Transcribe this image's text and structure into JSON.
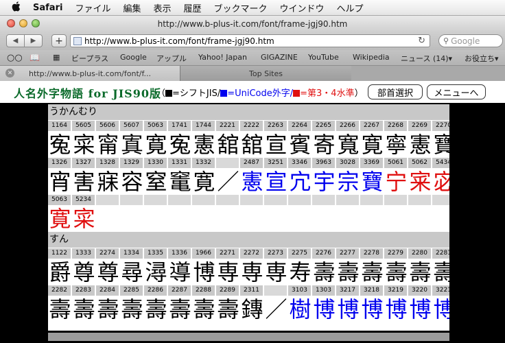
{
  "menubar": {
    "app": "Safari",
    "items": [
      "ファイル",
      "編集",
      "表示",
      "履歴",
      "ブックマーク",
      "ウインドウ",
      "ヘルプ"
    ]
  },
  "window": {
    "title": "http://www.b-plus-it.com/font/frame-jgj90.htm"
  },
  "toolbar": {
    "back": "◀",
    "forward": "▶",
    "add": "+",
    "url": "http://www.b-plus-it.com/font/frame-jgj90.htm",
    "search_placeholder": "Google"
  },
  "bookmarks": [
    {
      "label": "ビープラス"
    },
    {
      "label": "Google"
    },
    {
      "label": "アップル"
    },
    {
      "label": "Yahoo! Japan"
    },
    {
      "label": "GIGAZINE"
    },
    {
      "label": "YouTube"
    },
    {
      "label": "Wikipedia"
    },
    {
      "label": "ニュース (14)▾"
    },
    {
      "label": "お役立ち▾"
    }
  ],
  "tabs": [
    {
      "label": "http://www.b-plus-it.com/font/f..."
    },
    {
      "label": "Top Sites"
    }
  ],
  "header": {
    "title": "人名外字物語 for JIS90版",
    "legend": {
      "open": "（",
      "black_label": "=シフトJIS/",
      "blue_label": "=UniCode外字/",
      "red_label": "=第3・4水準",
      "close": "）"
    },
    "buttons": {
      "bushu": "部首選択",
      "menu": "メニューへ"
    }
  },
  "colors": {
    "shiftjis": "#000000",
    "unicode": "#0000ee",
    "level34": "#e01010",
    "title_green": "#0a6a2a"
  },
  "sections": [
    {
      "name": "うかんむり",
      "rows": [
        {
          "codes": [
            "1164",
            "5605",
            "5606",
            "5607",
            "5063",
            "1741",
            "1744",
            "2221",
            "2222",
            "2263",
            "2264",
            "2265",
            "2266",
            "2267",
            "2268",
            "2269",
            "2270"
          ],
          "chars": [
            {
              "t": "寃",
              "c": "black"
            },
            {
              "t": "寀",
              "c": "black"
            },
            {
              "t": "甯",
              "c": "black"
            },
            {
              "t": "寘",
              "c": "black"
            },
            {
              "t": "寛",
              "c": "black"
            },
            {
              "t": "寃",
              "c": "black"
            },
            {
              "t": "憲",
              "c": "black"
            },
            {
              "t": "舘",
              "c": "black"
            },
            {
              "t": "舘",
              "c": "black"
            },
            {
              "t": "宣",
              "c": "black"
            },
            {
              "t": "賓",
              "c": "black"
            },
            {
              "t": "寄",
              "c": "black"
            },
            {
              "t": "寬",
              "c": "black"
            },
            {
              "t": "寛",
              "c": "black"
            },
            {
              "t": "寧",
              "c": "black"
            },
            {
              "t": "憲",
              "c": "black"
            },
            {
              "t": "寶",
              "c": "black"
            }
          ]
        },
        {
          "codes": [
            "1326",
            "1327",
            "1328",
            "1329",
            "1330",
            "1331",
            "1332",
            "",
            "2487",
            "3251",
            "3346",
            "3963",
            "3028",
            "3369",
            "5061",
            "5062",
            "5434"
          ],
          "chars": [
            {
              "t": "宵",
              "c": "black"
            },
            {
              "t": "害",
              "c": "black"
            },
            {
              "t": "寐",
              "c": "black"
            },
            {
              "t": "容",
              "c": "black"
            },
            {
              "t": "窒",
              "c": "black"
            },
            {
              "t": "竃",
              "c": "black"
            },
            {
              "t": "寛",
              "c": "black"
            },
            {
              "t": "／",
              "c": "black"
            },
            {
              "t": "憲",
              "c": "blue"
            },
            {
              "t": "宣",
              "c": "blue"
            },
            {
              "t": "宂",
              "c": "blue"
            },
            {
              "t": "宇",
              "c": "blue"
            },
            {
              "t": "宗",
              "c": "blue"
            },
            {
              "t": "寶",
              "c": "blue"
            },
            {
              "t": "宁",
              "c": "red"
            },
            {
              "t": "宷",
              "c": "red"
            },
            {
              "t": "宓",
              "c": "red"
            }
          ]
        },
        {
          "codes": [
            "5063",
            "5234",
            "",
            "",
            "",
            "",
            "",
            "",
            "",
            "",
            "",
            "",
            "",
            "",
            "",
            "",
            ""
          ],
          "chars": [
            {
              "t": "寛",
              "c": "red"
            },
            {
              "t": "寀",
              "c": "red"
            }
          ]
        }
      ]
    },
    {
      "name": "すん",
      "rows": [
        {
          "codes": [
            "1122",
            "1333",
            "2274",
            "1334",
            "1335",
            "1336",
            "1966",
            "2271",
            "2272",
            "2273",
            "2275",
            "2276",
            "2277",
            "2278",
            "2279",
            "2280",
            "2281"
          ],
          "chars": [
            {
              "t": "爵",
              "c": "black"
            },
            {
              "t": "尊",
              "c": "black"
            },
            {
              "t": "尊",
              "c": "black"
            },
            {
              "t": "尋",
              "c": "black"
            },
            {
              "t": "潯",
              "c": "black"
            },
            {
              "t": "導",
              "c": "black"
            },
            {
              "t": "博",
              "c": "black"
            },
            {
              "t": "専",
              "c": "black"
            },
            {
              "t": "専",
              "c": "black"
            },
            {
              "t": "専",
              "c": "black"
            },
            {
              "t": "寿",
              "c": "black"
            },
            {
              "t": "壽",
              "c": "black"
            },
            {
              "t": "壽",
              "c": "black"
            },
            {
              "t": "壽",
              "c": "black"
            },
            {
              "t": "壽",
              "c": "black"
            },
            {
              "t": "壽",
              "c": "black"
            },
            {
              "t": "壽",
              "c": "black"
            }
          ]
        },
        {
          "codes": [
            "2282",
            "2283",
            "2284",
            "2285",
            "2286",
            "2287",
            "2288",
            "2289",
            "2311",
            "",
            "3103",
            "1303",
            "3217",
            "3218",
            "3219",
            "3220",
            "3221"
          ],
          "chars": [
            {
              "t": "壽",
              "c": "black"
            },
            {
              "t": "壽",
              "c": "black"
            },
            {
              "t": "壽",
              "c": "black"
            },
            {
              "t": "壽",
              "c": "black"
            },
            {
              "t": "壽",
              "c": "black"
            },
            {
              "t": "壽",
              "c": "black"
            },
            {
              "t": "壽",
              "c": "black"
            },
            {
              "t": "壽",
              "c": "black"
            },
            {
              "t": "鏄",
              "c": "black"
            },
            {
              "t": "／",
              "c": "black"
            },
            {
              "t": "樹",
              "c": "blue"
            },
            {
              "t": "博",
              "c": "blue"
            },
            {
              "t": "博",
              "c": "blue"
            },
            {
              "t": "博",
              "c": "blue"
            },
            {
              "t": "博",
              "c": "blue"
            },
            {
              "t": "博",
              "c": "blue"
            },
            {
              "t": "博",
              "c": "blue"
            }
          ]
        }
      ]
    }
  ]
}
